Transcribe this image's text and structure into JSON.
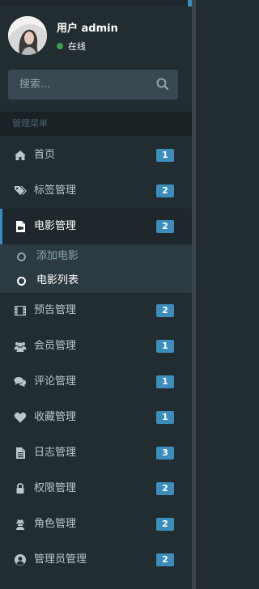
{
  "user": {
    "name": "用户 admin",
    "status": "在线"
  },
  "search": {
    "placeholder": "搜索..."
  },
  "menu_header": "管理菜单",
  "menu": [
    {
      "label": "首页",
      "badge": "1",
      "icon": "home-icon"
    },
    {
      "label": "标签管理",
      "badge": "2",
      "icon": "tags-icon"
    },
    {
      "label": "电影管理",
      "badge": "2",
      "icon": "video-file-icon",
      "active": true
    },
    {
      "label": "预告管理",
      "badge": "2",
      "icon": "film-icon"
    },
    {
      "label": "会员管理",
      "badge": "1",
      "icon": "users-icon"
    },
    {
      "label": "评论管理",
      "badge": "1",
      "icon": "comments-icon"
    },
    {
      "label": "收藏管理",
      "badge": "1",
      "icon": "heart-icon"
    },
    {
      "label": "日志管理",
      "badge": "3",
      "icon": "file-text-icon"
    },
    {
      "label": "权限管理",
      "badge": "2",
      "icon": "lock-icon"
    },
    {
      "label": "角色管理",
      "badge": "2",
      "icon": "user-secret-icon"
    },
    {
      "label": "管理员管理",
      "badge": "2",
      "icon": "user-circle-icon"
    }
  ],
  "submenu": [
    {
      "label": "添加电影",
      "active": false
    },
    {
      "label": "电影列表",
      "active": true
    }
  ],
  "colors": {
    "sidebar_bg": "#222d32",
    "accent": "#3c8dbc",
    "online": "#3c9e4d"
  }
}
